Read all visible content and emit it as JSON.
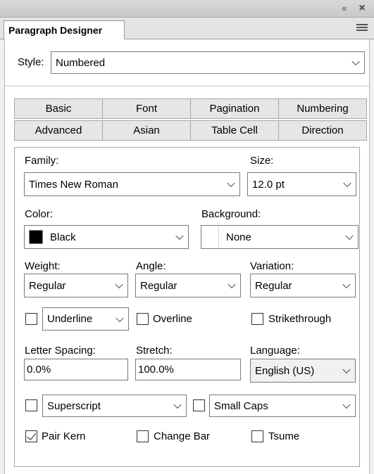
{
  "window": {
    "collapse_glyph": "«",
    "close_glyph": "×"
  },
  "panel_tab": {
    "title": "Paragraph Designer"
  },
  "style": {
    "label": "Style:",
    "value": "Numbered"
  },
  "tabs": {
    "row1": [
      "Basic",
      "Font",
      "Pagination",
      "Numbering"
    ],
    "row2": [
      "Advanced",
      "Asian",
      "Table Cell",
      "Direction"
    ],
    "active": "Font"
  },
  "font": {
    "family_label": "Family:",
    "family_value": "Times New Roman",
    "size_label": "Size:",
    "size_value": "12.0 pt",
    "color_label": "Color:",
    "color_value": "Black",
    "color_swatch": "#000000",
    "background_label": "Background:",
    "background_value": "None",
    "background_swatch": "#ffffff",
    "weight_label": "Weight:",
    "weight_value": "Regular",
    "angle_label": "Angle:",
    "angle_value": "Regular",
    "variation_label": "Variation:",
    "variation_value": "Regular",
    "underline_value": "Underline",
    "overline_label": "Overline",
    "strikethrough_label": "Strikethrough",
    "letter_spacing_label": "Letter Spacing:",
    "letter_spacing_value": "0.0%",
    "stretch_label": "Stretch:",
    "stretch_value": "100.0%",
    "language_label": "Language:",
    "language_value": "English (US)",
    "superscript_value": "Superscript",
    "smallcaps_value": "Small Caps",
    "pair_kern_label": "Pair Kern",
    "pair_kern_checked": true,
    "change_bar_label": "Change Bar",
    "tsume_label": "Tsume"
  }
}
